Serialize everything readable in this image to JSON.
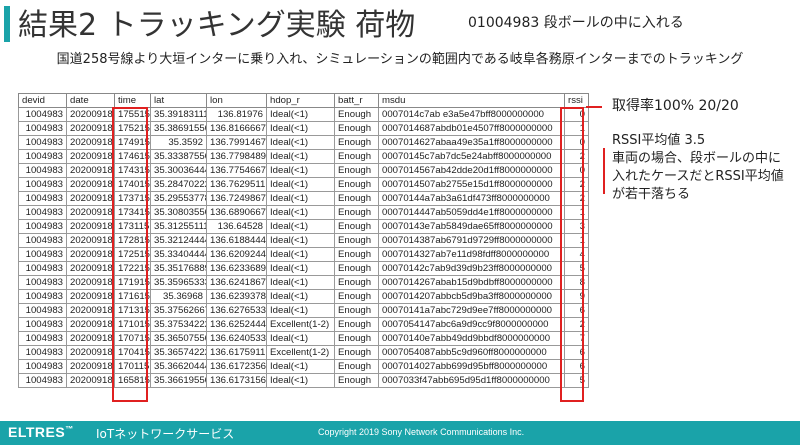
{
  "header": {
    "title": "結果2 トラッキング実験 荷物",
    "slide_id": "01004983 段ボールの中に入れる",
    "subtitle": "国道258号線より大垣インターに乗り入れ、シミュレーションの範囲内である岐阜各務原インターまでのトラッキング"
  },
  "table": {
    "columns": [
      "devid",
      "date",
      "time",
      "lat",
      "lon",
      "hdop_r",
      "batt_r",
      "msdu",
      "rssi"
    ],
    "rows": [
      [
        "1004983",
        "20200918",
        "175515",
        "35.39183111",
        "136.81976",
        "Ideal(<1)",
        "Enough",
        "0007014c7ab e3a5e47bff8000000000",
        "0"
      ],
      [
        "1004983",
        "20200918",
        "175215",
        "35.38691556",
        "136.8166667",
        "Ideal(<1)",
        "Enough",
        "0007014687abdb01e4507ff8000000000",
        "1"
      ],
      [
        "1004983",
        "20200918",
        "174915",
        "35.3592",
        "136.7991467",
        "Ideal(<1)",
        "Enough",
        "0007014627abaa49e35a1ff8000000000",
        "0"
      ],
      [
        "1004983",
        "20200918",
        "174615",
        "35.33387556",
        "136.7798489",
        "Ideal(<1)",
        "Enough",
        "00070145c7ab7dc5e24abff8000000000",
        "2"
      ],
      [
        "1004983",
        "20200918",
        "174315",
        "35.30036444",
        "136.7754667",
        "Ideal(<1)",
        "Enough",
        "0007014567ab42dde20d1ff8000000000",
        "0"
      ],
      [
        "1004983",
        "20200918",
        "174015",
        "35.28470222",
        "136.7629511",
        "Ideal(<1)",
        "Enough",
        "0007014507ab2755e15d1ff8000000000",
        "2"
      ],
      [
        "1004983",
        "20200918",
        "173715",
        "35.29553778",
        "136.7249867",
        "Ideal(<1)",
        "Enough",
        "00070144a7ab3a61df473ff8000000000",
        "2"
      ],
      [
        "1004983",
        "20200918",
        "173415",
        "35.30803556",
        "136.6890667",
        "Ideal(<1)",
        "Enough",
        "0007014447ab5059dd4e1ff8000000000",
        "1"
      ],
      [
        "1004983",
        "20200918",
        "173115",
        "35.31255111",
        "136.64528",
        "Ideal(<1)",
        "Enough",
        "00070143e7ab5849dae65ff8000000000",
        "3"
      ],
      [
        "1004983",
        "20200918",
        "172815",
        "35.32124444",
        "136.6188444",
        "Ideal(<1)",
        "Enough",
        "0007014387ab6791d9729ff8000000000",
        "1"
      ],
      [
        "1004983",
        "20200918",
        "172515",
        "35.33404444",
        "136.6209244",
        "Ideal(<1)",
        "Enough",
        "0007014327ab7e11d98fdff8000000000",
        "4"
      ],
      [
        "1004983",
        "20200918",
        "172215",
        "35.35176889",
        "136.6233689",
        "Ideal(<1)",
        "Enough",
        "00070142c7ab9d39d9b23ff8000000000",
        "5"
      ],
      [
        "1004983",
        "20200918",
        "171915",
        "35.35965333",
        "136.6241867",
        "Ideal(<1)",
        "Enough",
        "0007014267abab15d9bdbff8000000000",
        "8"
      ],
      [
        "1004983",
        "20200918",
        "171615",
        "35.36968",
        "136.6239378",
        "Ideal(<1)",
        "Enough",
        "0007014207abbcb5d9ba3ff8000000000",
        "9"
      ],
      [
        "1004983",
        "20200918",
        "171315",
        "35.37562667",
        "136.6276533",
        "Ideal(<1)",
        "Enough",
        "00070141a7abc729d9ee7ff8000000000",
        "6"
      ],
      [
        "1004983",
        "20200918",
        "171015",
        "35.37534222",
        "136.6252444",
        "Excellent(1-2)",
        "Enough",
        "0007054147abc6a9d9cc9f8000000000",
        "2"
      ],
      [
        "1004983",
        "20200918",
        "170715",
        "35.36507556",
        "136.6240533",
        "Ideal(<1)",
        "Enough",
        "00070140e7abb49dd9bbdf8000000000",
        "7"
      ],
      [
        "1004983",
        "20200918",
        "170415",
        "35.36574222",
        "136.6175911",
        "Excellent(1-2)",
        "Enough",
        "0007054087abb5c9d960ff8000000000",
        "6"
      ],
      [
        "1004983",
        "20200918",
        "170115",
        "35.36620444",
        "136.6172356",
        "Ideal(<1)",
        "Enough",
        "0007014027abb699d95bff8000000000",
        "6"
      ],
      [
        "1004983",
        "20200918",
        "165815",
        "35.36619556",
        "136.6173156",
        "Ideal(<1)",
        "Enough",
        "0007033f47abb695d95d1ff8000000000",
        "5"
      ]
    ]
  },
  "notes": {
    "acquisition": "取得率100%  20/20",
    "rssi_avg": "RSSI平均値 3.5",
    "comment_line1": "車両の場合、段ボールの中に",
    "comment_line2": "入れたケースだとRSSI平均値",
    "comment_line3": "が若干落ちる"
  },
  "footer": {
    "brand": "ELTRES",
    "trademark": "™",
    "service": "IoTネットワークサービス",
    "copyright": "Copyright 2019 Sony Network Communications Inc."
  },
  "colors": {
    "accent": "#1aa3a9",
    "highlight": "#e02020"
  }
}
